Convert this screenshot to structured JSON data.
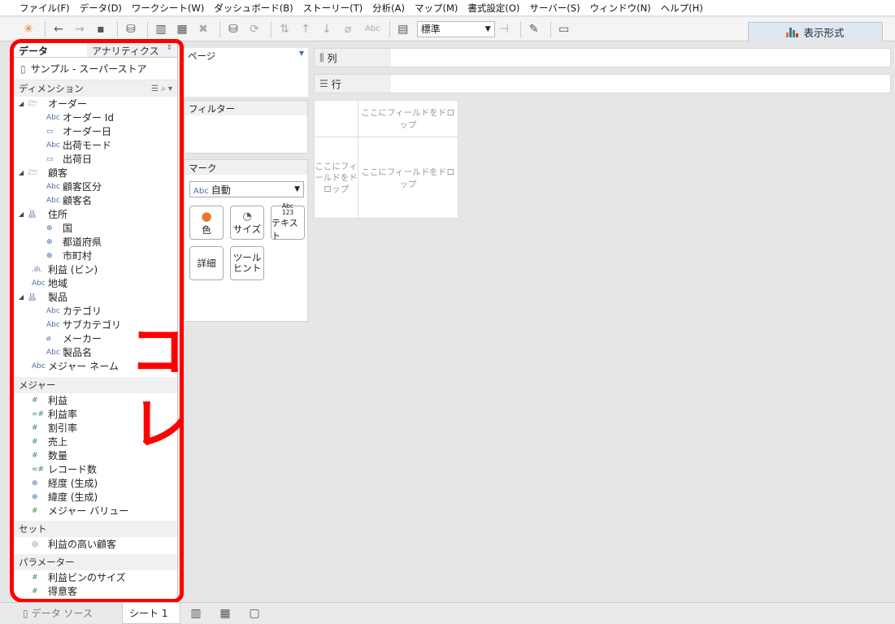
{
  "menu": [
    "ファイル(F)",
    "データ(D)",
    "ワークシート(W)",
    "ダッシュボード(B)",
    "ストーリー(T)",
    "分析(A)",
    "マップ(M)",
    "書式設定(O)",
    "サーバー(S)",
    "ウィンドウ(N)",
    "ヘルプ(H)"
  ],
  "toolbar": {
    "zoom_value": "標準",
    "abc_label": "Abc",
    "show_me_label": "表示形式"
  },
  "left": {
    "data_tab": "データ",
    "analytics_tab": "アナリティクス",
    "datasource": "サンプル - スーパーストア",
    "dimensions_header": "ディメンション",
    "dimensions": [
      {
        "label": "オーダー",
        "kind": "folder",
        "indent": 0
      },
      {
        "label": "オーダー Id",
        "kind": "abc",
        "indent": 1
      },
      {
        "label": "オーダー日",
        "kind": "date",
        "indent": 1
      },
      {
        "label": "出荷モード",
        "kind": "abc",
        "indent": 1
      },
      {
        "label": "出荷日",
        "kind": "date",
        "indent": 1
      },
      {
        "label": "顧客",
        "kind": "folder",
        "indent": 0
      },
      {
        "label": "顧客区分",
        "kind": "abc",
        "indent": 1
      },
      {
        "label": "顧客名",
        "kind": "abc",
        "indent": 1
      },
      {
        "label": "住所",
        "kind": "hier",
        "indent": 0
      },
      {
        "label": "国",
        "kind": "geo",
        "indent": 1
      },
      {
        "label": "都道府県",
        "kind": "geo",
        "indent": 1
      },
      {
        "label": "市町村",
        "kind": "geo",
        "indent": 1
      },
      {
        "label": "利益 (ビン)",
        "kind": "bin",
        "indent": 0
      },
      {
        "label": "地域",
        "kind": "abc",
        "indent": 0
      },
      {
        "label": "製品",
        "kind": "hier",
        "indent": 0
      },
      {
        "label": "カテゴリ",
        "kind": "abc",
        "indent": 1
      },
      {
        "label": "サブカテゴリ",
        "kind": "abc",
        "indent": 1
      },
      {
        "label": "メーカー",
        "kind": "clip",
        "indent": 1
      },
      {
        "label": "製品名",
        "kind": "abc",
        "indent": 1
      },
      {
        "label": "メジャー ネーム",
        "kind": "abc",
        "indent": 0
      }
    ],
    "measures_header": "メジャー",
    "measures": [
      {
        "label": "利益",
        "kind": "num"
      },
      {
        "label": "利益率",
        "kind": "calc"
      },
      {
        "label": "割引率",
        "kind": "num"
      },
      {
        "label": "売上",
        "kind": "num"
      },
      {
        "label": "数量",
        "kind": "num"
      },
      {
        "label": "レコード数",
        "kind": "calc"
      },
      {
        "label": "経度 (生成)",
        "kind": "geo"
      },
      {
        "label": "緯度 (生成)",
        "kind": "geo"
      },
      {
        "label": "メジャー バリュー",
        "kind": "num"
      }
    ],
    "sets_header": "セット",
    "sets": [
      {
        "label": "利益の高い顧客"
      }
    ],
    "params_header": "パラメーター",
    "params": [
      {
        "label": "利益ビンのサイズ"
      },
      {
        "label": "得意客"
      }
    ]
  },
  "pages": {
    "title": "ページ"
  },
  "filters": {
    "title": "フィルター"
  },
  "marks": {
    "title": "マーク",
    "type_label": "自動",
    "abc": "Abc",
    "color": "色",
    "size": "サイズ",
    "text": "テキスト",
    "text_icon": "Abc\n123",
    "detail": "詳細",
    "tooltip": "ツール\nヒント"
  },
  "shelves": {
    "columns": "列",
    "rows": "行"
  },
  "view": {
    "drop_top": "ここにフィールドをドロップ",
    "drop_left": "ここにフィ\nールドをド\nロップ",
    "drop_main": "ここにフィールドをドロップ"
  },
  "bottom": {
    "datasource_tab": "データ ソース",
    "sheet_tab": "シート 1"
  },
  "colors": {
    "annotation": "#ff0000",
    "accent": "#4a6da7"
  }
}
